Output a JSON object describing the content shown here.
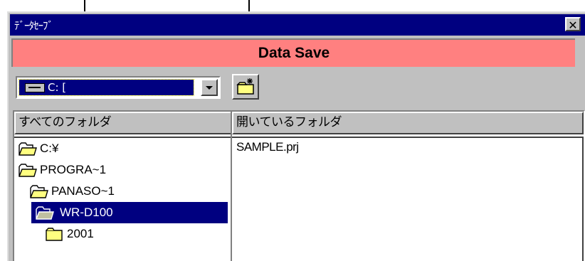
{
  "window": {
    "title": "ﾃﾞｰﾀｾｰﾌﾞ",
    "close_glyph": "✕"
  },
  "banner": {
    "text": "Data Save"
  },
  "drive": {
    "label": "C: ["
  },
  "panels": {
    "all_folders_header": "すべてのフォルダ",
    "open_folder_header": "開いているフォルダ"
  },
  "folders": [
    {
      "label": "C:¥",
      "icon": "open-folder-icon",
      "selected": false
    },
    {
      "label": "PROGRA~1",
      "icon": "open-folder-icon",
      "selected": false
    },
    {
      "label": "PANASO~1",
      "icon": "open-folder-icon",
      "selected": false
    },
    {
      "label": "WR-D100",
      "icon": "open-folder-icon",
      "selected": true
    },
    {
      "label": "2001",
      "icon": "folder-icon",
      "selected": false
    }
  ],
  "files": [
    {
      "label": "SAMPLE.prj"
    }
  ],
  "colors": {
    "titlebar": "#000080",
    "banner": "#ff8080",
    "selection": "#000080",
    "face": "#c0c0c0"
  }
}
